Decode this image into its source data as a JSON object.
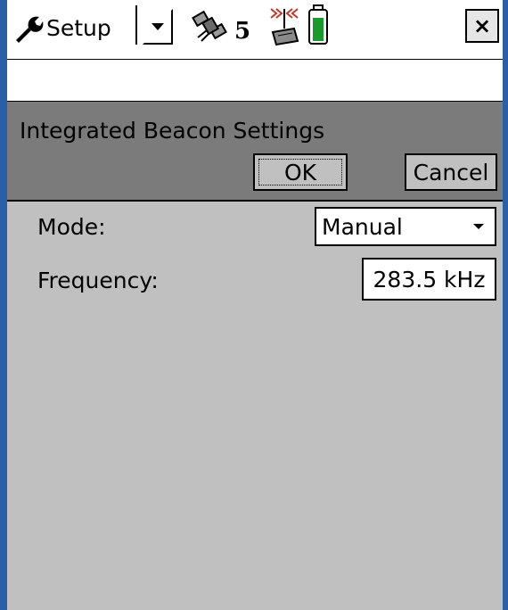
{
  "statusbar": {
    "app_menu_label": "Setup",
    "satellite_count": "5",
    "close_label": "×"
  },
  "page": {
    "title": "Integrated Beacon Settings",
    "ok_label": "OK",
    "cancel_label": "Cancel"
  },
  "form": {
    "mode_label": "Mode:",
    "mode_value": "Manual",
    "frequency_label": "Frequency:",
    "frequency_value": "283.5 kHz"
  },
  "icons": {
    "app_menu": "wrench-icon",
    "menu_dropdown": "chevron-down-icon",
    "satellites": "satellite-icon",
    "beacon": "beacon-antenna-icon",
    "battery": "battery-icon",
    "select_dropdown": "chevron-down-icon"
  },
  "colors": {
    "battery_level": "#1a9a2a",
    "header_panel": "#7b7b7b",
    "body_background": "#c0c0c0"
  }
}
